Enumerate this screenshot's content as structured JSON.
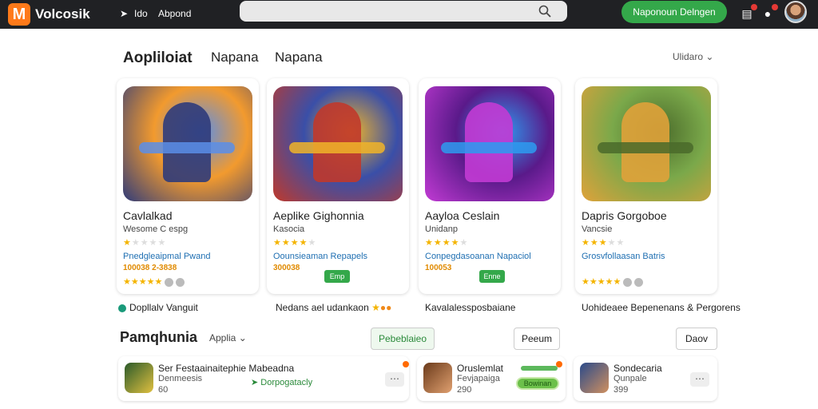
{
  "topbar": {
    "logo_letter": "M",
    "brand": "Volcosik",
    "nav": [
      "Ido",
      "Abpond"
    ],
    "search_placeholder": "",
    "cta_label": "Naponoun Delngen"
  },
  "tabs": [
    {
      "label": "Aopliloiat",
      "active": true
    },
    {
      "label": "Napana",
      "active": false
    },
    {
      "label": "Napana",
      "active": false
    }
  ],
  "sort_label": "Ulidaro",
  "cards": [
    {
      "title": "Cavlalkad",
      "subtitle": "Wesome C espg",
      "stars": 1,
      "developer": "Pnedgleaipmal Pwand",
      "price": "100038 2-3838",
      "rating": 5,
      "below_text": "Dopllalv Vanguit",
      "colors": [
        "#f29a2e",
        "#2f3b7a",
        "#5a8ee8"
      ]
    },
    {
      "title": "Aeplike Gighonnia",
      "subtitle": "Kasocia",
      "stars": 4,
      "developer": "Oounsieaman Repapels",
      "price": "300038",
      "get_label": "Emp",
      "below_text": "Nedans ael udankaon",
      "colors": [
        "#3a4fa8",
        "#c0392b",
        "#f0b429"
      ]
    },
    {
      "title": "Aayloa Ceslain",
      "subtitle": "Unidanp",
      "stars": 4,
      "developer": "Conpegdasoanan Napaciol",
      "price": "100053",
      "get_label": "Enne",
      "below_text": "Kavalalessposbaiane",
      "colors": [
        "#5a1a8a",
        "#c23bd4",
        "#2d9bf0"
      ]
    },
    {
      "title": "Dapris Gorgoboe",
      "subtitle": "Vancsie",
      "stars": 3,
      "developer": "Grosvfollaasan Batris",
      "price": "",
      "rating": 5,
      "below_text": "Uohideaee Bepenenans & Pergorens",
      "colors": [
        "#7aa84a",
        "#e0a23a",
        "#4a6a2a"
      ]
    }
  ],
  "section2": {
    "title": "Pamqhunia",
    "filter_label": "Applia",
    "pills": [
      "Pebeblaieo",
      "Peeum",
      "Daov"
    ],
    "rows": [
      {
        "title": "Ser Festaainaitephie Mabeadna",
        "sub": "Denmeesis",
        "meta": "60",
        "link": "Dorpogatacly"
      },
      {
        "title": "Oruslemlat",
        "sub": "Fevjapaiga",
        "meta": "290",
        "btn": "Bowinan"
      },
      {
        "title": "Sondecaria",
        "sub": "Qunpale",
        "meta": "399"
      }
    ]
  }
}
